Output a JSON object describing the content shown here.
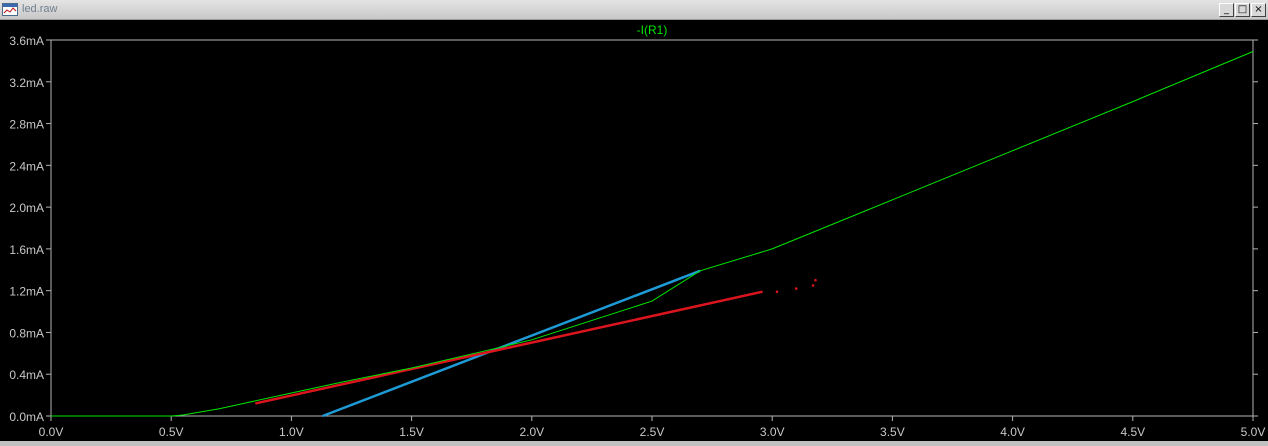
{
  "window": {
    "title": "led.raw",
    "buttons": {
      "minimize": "_",
      "maximize": "□",
      "close": "×"
    },
    "icon": "waveform-viewer-icon"
  },
  "colors": {
    "background": "#000000",
    "axis": "#b4b4b4",
    "tick_label": "#c8c8c8",
    "trace_label": "#00e600",
    "trace": "#00e600",
    "line_blue": "#1e9bd7",
    "line_red": "#dc141e"
  },
  "chart_data": {
    "type": "line",
    "title": "",
    "xlabel": "",
    "ylabel": "",
    "xlim": [
      0,
      5
    ],
    "ylim": [
      0,
      3.6
    ],
    "grid": false,
    "x_ticks": [
      0,
      0.5,
      1.0,
      1.5,
      2.0,
      2.5,
      3.0,
      3.5,
      4.0,
      4.5,
      5.0
    ],
    "x_tick_labels": [
      "0.0V",
      "0.5V",
      "1.0V",
      "1.5V",
      "2.0V",
      "2.5V",
      "3.0V",
      "3.5V",
      "4.0V",
      "4.5V",
      "5.0V"
    ],
    "y_ticks": [
      0,
      0.4,
      0.8,
      1.2,
      1.6,
      2.0,
      2.4,
      2.8,
      3.2,
      3.6
    ],
    "y_tick_labels": [
      "0.0mA",
      "0.4mA",
      "0.8mA",
      "1.2mA",
      "1.6mA",
      "2.0mA",
      "2.4mA",
      "2.8mA",
      "3.2mA",
      "3.6mA"
    ],
    "series": [
      {
        "name": "-I(R1)",
        "color": "#00e600",
        "x": [
          0,
          0.5,
          0.55,
          0.6,
          0.7,
          0.8,
          1.0,
          1.2,
          1.5,
          1.8,
          2.0,
          2.5,
          2.7,
          3.0,
          3.5,
          4.0,
          4.5,
          5.0
        ],
        "y": [
          0,
          0,
          0.01,
          0.03,
          0.07,
          0.12,
          0.22,
          0.32,
          0.46,
          0.62,
          0.73,
          1.1,
          1.39,
          1.6,
          2.07,
          2.54,
          3.01,
          3.49
        ]
      }
    ],
    "annotation_lines": [
      {
        "color": "#1e9bd7",
        "x": [
          1.13,
          2.7
        ],
        "y": [
          0.0,
          1.39
        ]
      },
      {
        "color": "#dc141e",
        "x": [
          0.85,
          2.96
        ],
        "y": [
          0.12,
          1.19
        ]
      }
    ],
    "annotation_dots": {
      "color": "#dc141e",
      "x": [
        3.02,
        3.1,
        3.17,
        3.18
      ],
      "y": [
        1.19,
        1.22,
        1.25,
        1.3
      ]
    }
  }
}
